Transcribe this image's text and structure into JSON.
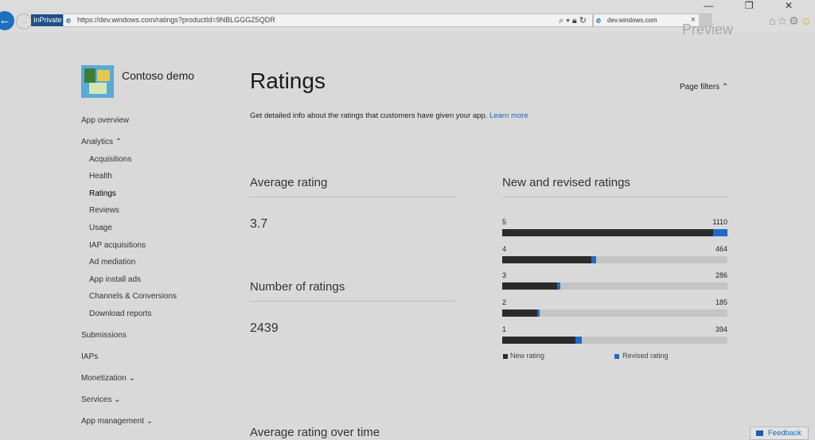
{
  "browser": {
    "private_label": "InPrivate",
    "url": "https://dev.windows.com/ratings?productId=9NBLGGGZ5QDR",
    "tab_title": "dev.windows.com",
    "tab_close": "×",
    "window_controls": "—  ❐  ✕",
    "preview_label": "Preview"
  },
  "sidebar": {
    "app_name": "Contoso demo",
    "items": [
      {
        "label": "App overview"
      },
      {
        "label": "Analytics",
        "chevron": "up"
      },
      {
        "label": "Acquisitions"
      },
      {
        "label": "Health"
      },
      {
        "label": "Ratings"
      },
      {
        "label": "Reviews"
      },
      {
        "label": "Usage"
      },
      {
        "label": "IAP acquisitions"
      },
      {
        "label": "Ad mediation"
      },
      {
        "label": "App install ads"
      },
      {
        "label": "Channels & Conversions"
      },
      {
        "label": "Download reports"
      },
      {
        "label": "Submissions"
      },
      {
        "label": "IAPs"
      },
      {
        "label": "Monetization",
        "chevron": "down"
      },
      {
        "label": "Services",
        "chevron": "down"
      },
      {
        "label": "App management",
        "chevron": "down"
      }
    ],
    "active_item": "Ratings"
  },
  "main": {
    "title": "Ratings",
    "page_filters": "Page filters",
    "intro_text": "Get detailed info about the ratings that customers have given your app.",
    "learn_more": "Learn more",
    "average_rating_title": "Average rating",
    "average_rating_value": "3.7",
    "number_of_ratings_title": "Number of ratings",
    "number_of_ratings_value": "2439",
    "new_revised_title": "New and revised ratings",
    "over_time_title": "Average rating over time"
  },
  "chart_data": {
    "type": "bar",
    "orientation": "horizontal",
    "title": "New and revised ratings",
    "categories": [
      "5",
      "4",
      "3",
      "2",
      "1"
    ],
    "totals": [
      1110,
      464,
      286,
      185,
      394
    ],
    "max_total": 1110,
    "series": [
      {
        "name": "New rating",
        "color": "#2b2b2b",
        "values": [
          1040,
          439,
          270,
          174,
          362
        ]
      },
      {
        "name": "Revised rating",
        "color": "#1e6bc4",
        "values": [
          70,
          25,
          16,
          11,
          32
        ]
      }
    ],
    "legend_position": "bottom"
  },
  "feedback": {
    "label": "Feedback"
  },
  "colors": {
    "accent": "#1e6bc4",
    "background": "#d9d9d9",
    "bar_new": "#2b2b2b",
    "bar_track": "#c4c4c4"
  }
}
